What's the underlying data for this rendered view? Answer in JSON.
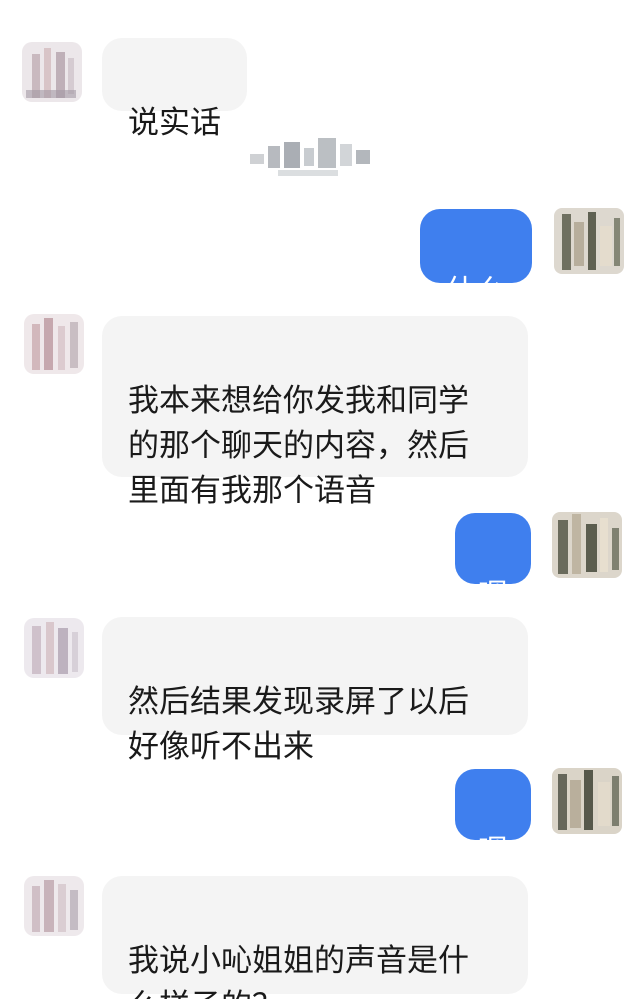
{
  "colors": {
    "incoming_bubble": "#f4f4f4",
    "outgoing_bubble": "#3f7fee",
    "incoming_text": "#1a1a1a",
    "outgoing_text": "#ffffff"
  },
  "messages": [
    {
      "direction": "in",
      "text": "说实话"
    },
    {
      "direction": "in",
      "type": "sticker",
      "icon": "blurred-sticker"
    },
    {
      "direction": "out",
      "text": "什么"
    },
    {
      "direction": "in",
      "text": "我本来想给你发我和同学\n的那个聊天的内容，然后\n里面有我那个语音"
    },
    {
      "direction": "out",
      "text": "嗯"
    },
    {
      "direction": "in",
      "text": "然后结果发现录屏了以后\n好像听不出来"
    },
    {
      "direction": "out",
      "text": "嗯"
    },
    {
      "direction": "in",
      "text": "我说小吣姐姐的声音是什\n么样子的？"
    }
  ]
}
